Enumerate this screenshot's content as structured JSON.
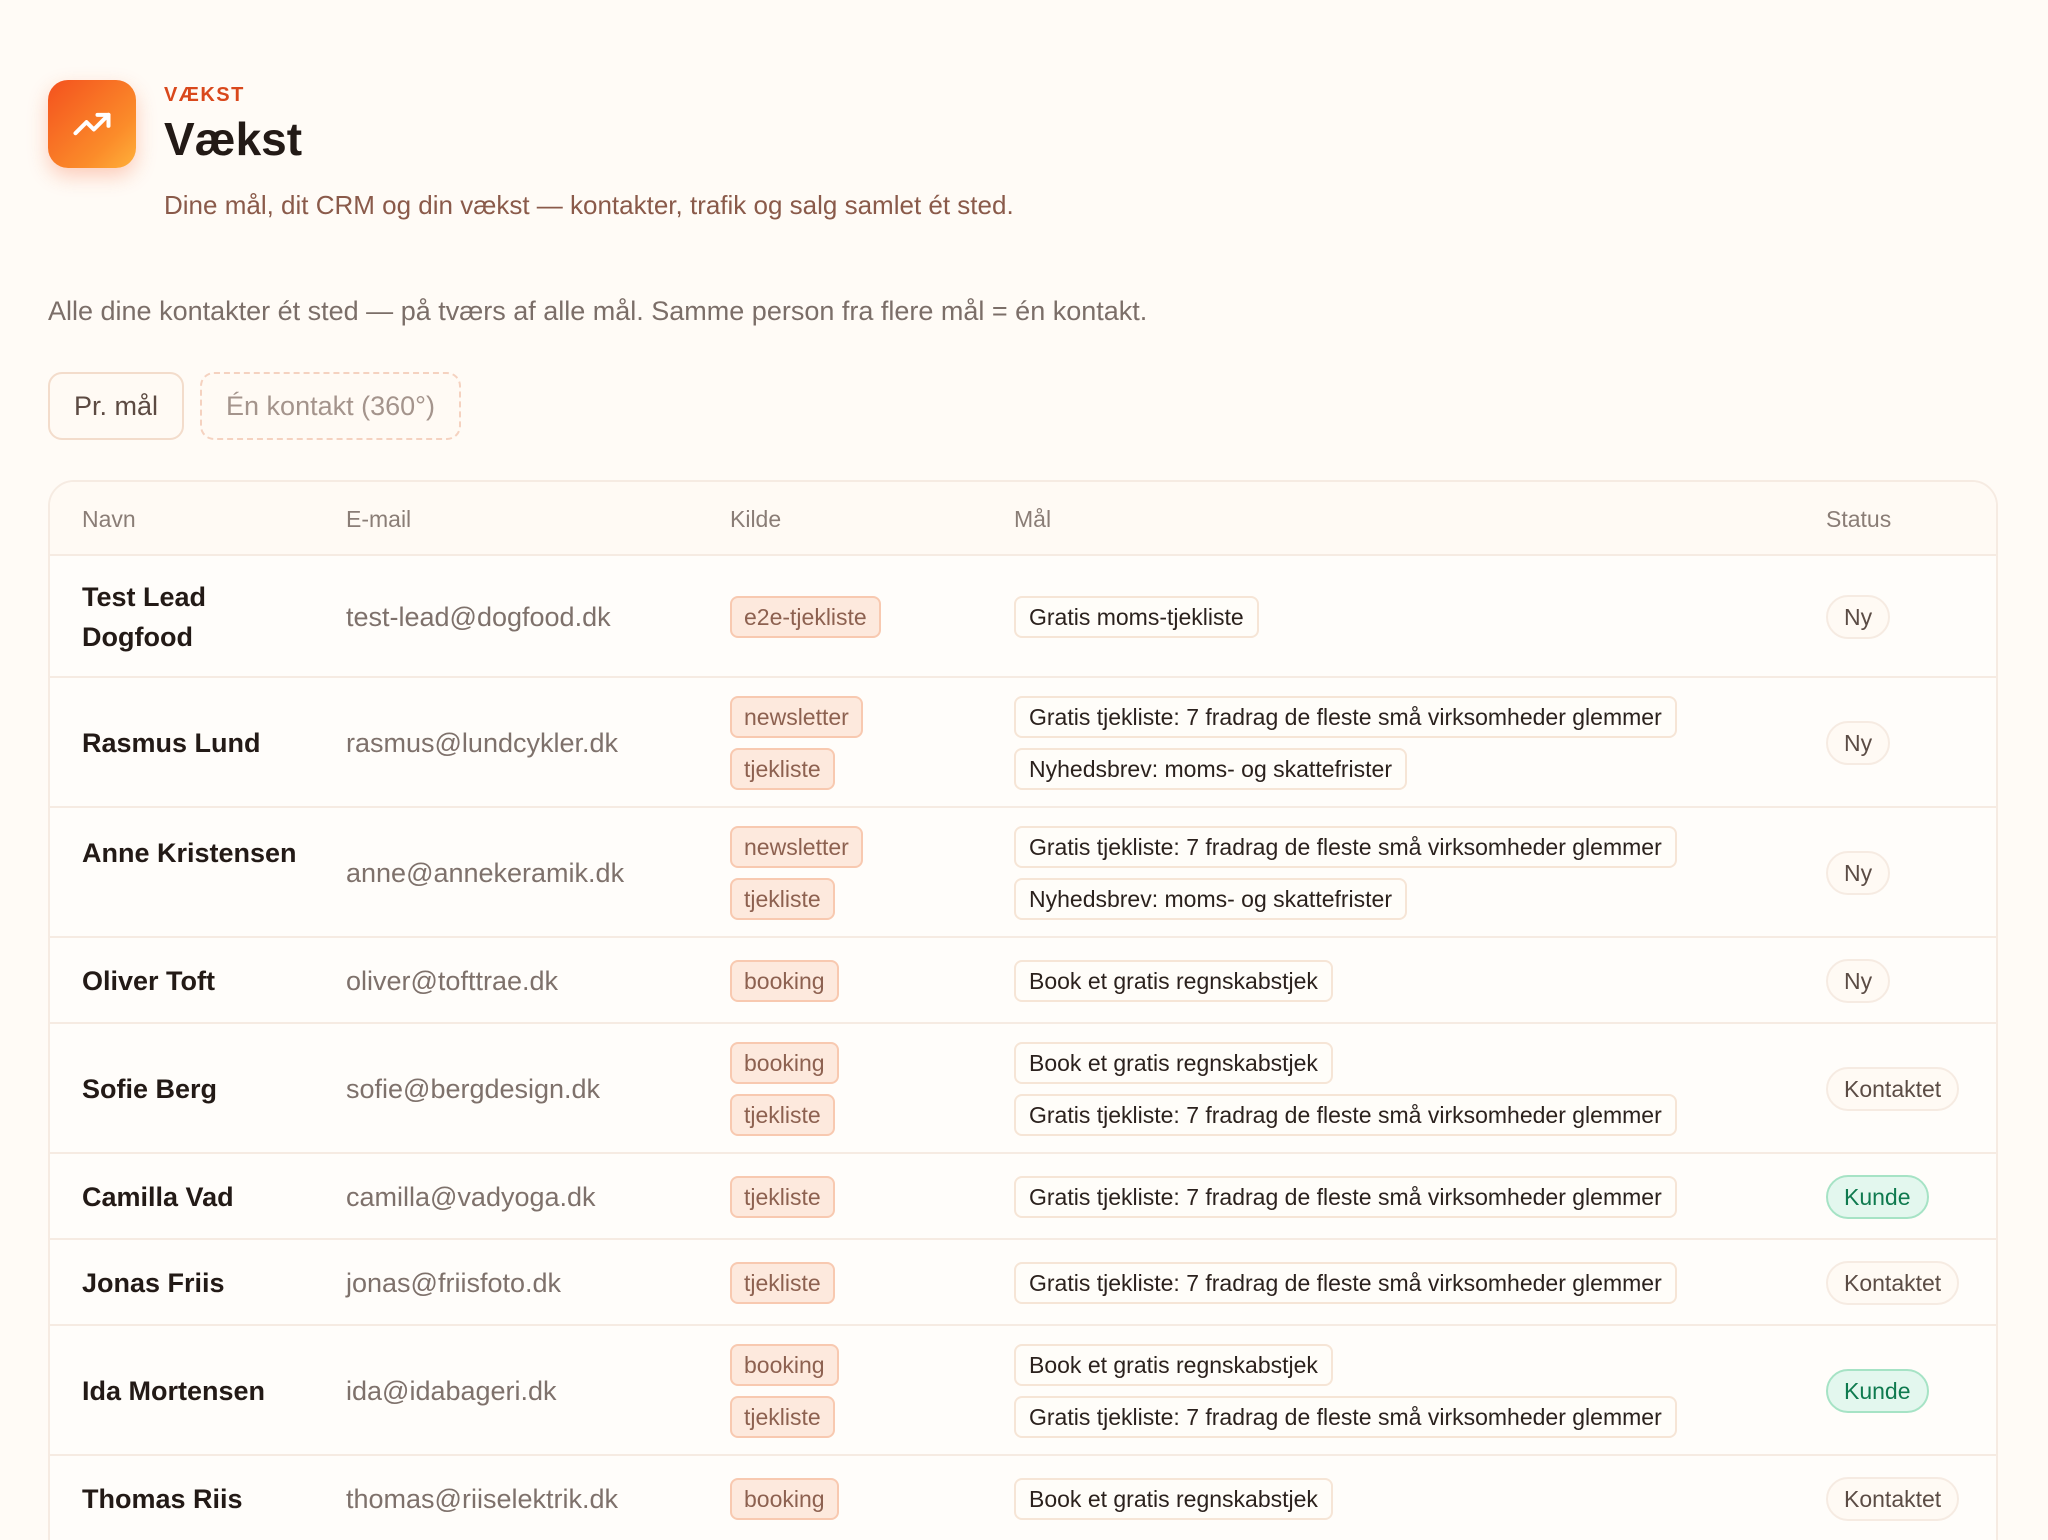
{
  "header": {
    "eyebrow": "VÆKST",
    "title": "Vækst",
    "subtitle": "Dine mål, dit CRM og din vækst — kontakter, trafik og salg samlet ét sted.",
    "icon": "trending-up-icon"
  },
  "intro": "Alle dine kontakter ét sted — på tværs af alle mål. Samme person fra flere mål = én kontakt.",
  "view_tabs": [
    {
      "label": "Pr. mål",
      "active": true
    },
    {
      "label": "Én kontakt (360°)",
      "active": false
    }
  ],
  "table": {
    "columns": [
      "Navn",
      "E-mail",
      "Kilde",
      "Mål",
      "Status"
    ],
    "rows": [
      {
        "name": "Test Lead Dogfood",
        "email": "test-lead@dogfood.dk",
        "sources": [
          "e2e-tjekliste"
        ],
        "goals": [
          "Gratis moms-tjekliste"
        ],
        "status": "Ny"
      },
      {
        "name": "Rasmus Lund",
        "email": "rasmus@lundcykler.dk",
        "sources": [
          "newsletter",
          "tjekliste"
        ],
        "goals": [
          "Gratis tjekliste: 7 fradrag de fleste små virksomheder glemmer",
          "Nyhedsbrev: moms- og skattefrister"
        ],
        "status": "Ny"
      },
      {
        "name": "Anne Kristensen",
        "email": "anne@annekeramik.dk",
        "sources": [
          "newsletter",
          "tjekliste"
        ],
        "goals": [
          "Gratis tjekliste: 7 fradrag de fleste små virksomheder glemmer",
          "Nyhedsbrev: moms- og skattefrister"
        ],
        "status": "Ny"
      },
      {
        "name": "Oliver Toft",
        "email": "oliver@tofttrae.dk",
        "sources": [
          "booking"
        ],
        "goals": [
          "Book et gratis regnskabstjek"
        ],
        "status": "Ny"
      },
      {
        "name": "Sofie Berg",
        "email": "sofie@bergdesign.dk",
        "sources": [
          "booking",
          "tjekliste"
        ],
        "goals": [
          "Book et gratis regnskabstjek",
          "Gratis tjekliste: 7 fradrag de fleste små virksomheder glemmer"
        ],
        "status": "Kontaktet"
      },
      {
        "name": "Camilla Vad",
        "email": "camilla@vadyoga.dk",
        "sources": [
          "tjekliste"
        ],
        "goals": [
          "Gratis tjekliste: 7 fradrag de fleste små virksomheder glemmer"
        ],
        "status": "Kunde"
      },
      {
        "name": "Jonas Friis",
        "email": "jonas@friisfoto.dk",
        "sources": [
          "tjekliste"
        ],
        "goals": [
          "Gratis tjekliste: 7 fradrag de fleste små virksomheder glemmer"
        ],
        "status": "Kontaktet"
      },
      {
        "name": "Ida Mortensen",
        "email": "ida@idabageri.dk",
        "sources": [
          "booking",
          "tjekliste"
        ],
        "goals": [
          "Book et gratis regnskabstjek",
          "Gratis tjekliste: 7 fradrag de fleste små virksomheder glemmer"
        ],
        "status": "Kunde"
      },
      {
        "name": "Thomas Riis",
        "email": "thomas@riiselektrik.dk",
        "sources": [
          "booking"
        ],
        "goals": [
          "Book et gratis regnskabstjek"
        ],
        "status": "Kontaktet"
      }
    ]
  },
  "colors": {
    "accent": "#f4511e",
    "eyebrow": "#d9481c",
    "status_kunde": "#0f7a4f",
    "source_tag_bg": "#fde9dd"
  }
}
